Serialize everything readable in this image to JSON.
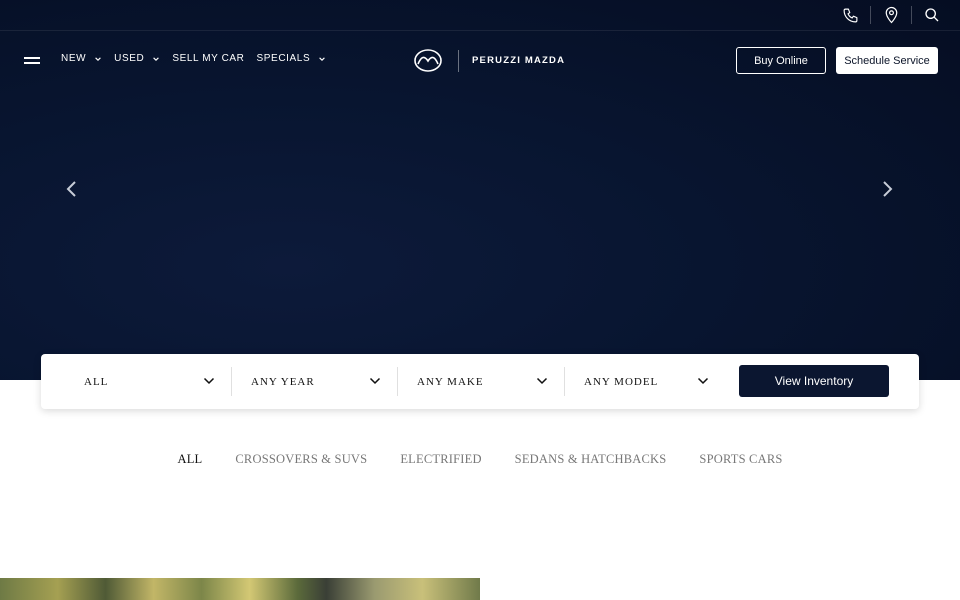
{
  "topbar": {
    "icons": [
      "phone-icon",
      "location-pin-icon",
      "search-icon"
    ]
  },
  "nav": {
    "items": [
      {
        "label": "NEW",
        "has_dropdown": true
      },
      {
        "label": "USED",
        "has_dropdown": true
      },
      {
        "label": "SELL MY CAR",
        "has_dropdown": false
      },
      {
        "label": "SPECIALS",
        "has_dropdown": true
      }
    ],
    "brand_name": "PERUZZI MAZDA",
    "buy_online": "Buy Online",
    "schedule_service": "Schedule Service"
  },
  "search": {
    "filters": [
      "ALL",
      "ANY YEAR",
      "ANY MAKE",
      "ANY MODEL"
    ],
    "submit": "View Inventory"
  },
  "categories": {
    "items": [
      "ALL",
      "CROSSOVERS & SUVS",
      "ELECTRIFIED",
      "SEDANS & HATCHBACKS",
      "SPORTS CARS"
    ],
    "active": "ALL"
  },
  "colors": {
    "hero_bg": "#081530",
    "primary_button": "#0b1630",
    "inactive_tab": "#777777"
  }
}
